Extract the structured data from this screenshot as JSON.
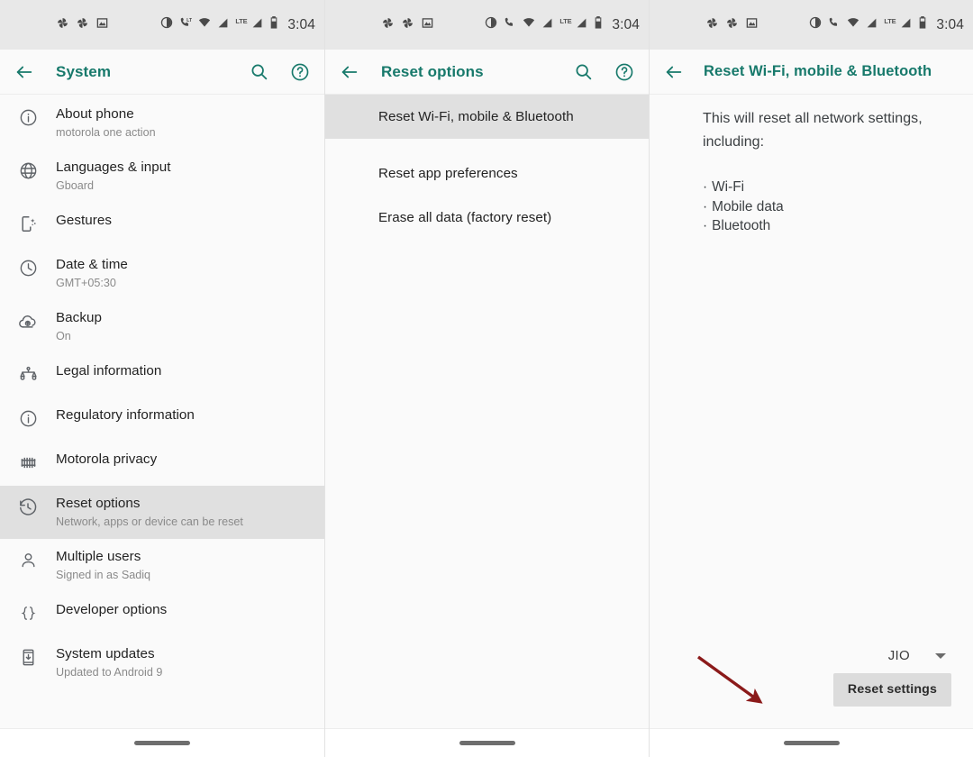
{
  "meta": {
    "accent_color": "#17796b",
    "selected_row_bg": "#e0e0e0",
    "annotation_color": "#8b1a1a",
    "page_bg": "#fafafa"
  },
  "status_bar": {
    "time": "3:04",
    "lte_label": "LTE",
    "left_icons": [
      "sparkle-icon",
      "sparkle-icon",
      "photo-icon"
    ],
    "right_icons": [
      "do-not-disturb-icon",
      "volte-call-icon",
      "wifi-icon",
      "signal-bars-icon",
      "signal-bars-icon",
      "battery-icon"
    ]
  },
  "panels": [
    {
      "id": "system",
      "app_bar": {
        "back": "back-arrow-icon",
        "title": "System",
        "actions": [
          "search-icon",
          "help-icon"
        ]
      },
      "items": [
        {
          "icon": "info-circle-icon",
          "title": "About phone",
          "subtitle": "motorola one action",
          "selected": false
        },
        {
          "icon": "globe-icon",
          "title": "Languages & input",
          "subtitle": "Gboard",
          "selected": false
        },
        {
          "icon": "gestures-phone-icon",
          "title": "Gestures",
          "subtitle": "",
          "selected": false
        },
        {
          "icon": "clock-icon",
          "title": "Date & time",
          "subtitle": "GMT+05:30",
          "selected": false
        },
        {
          "icon": "cloud-upload-icon",
          "title": "Backup",
          "subtitle": "On",
          "selected": false
        },
        {
          "icon": "scales-icon",
          "title": "Legal information",
          "subtitle": "",
          "selected": false
        },
        {
          "icon": "info-circle-icon",
          "title": "Regulatory information",
          "subtitle": "",
          "selected": false
        },
        {
          "icon": "privacy-grid-icon",
          "title": "Motorola privacy",
          "subtitle": "",
          "selected": false
        },
        {
          "icon": "history-reset-icon",
          "title": "Reset options",
          "subtitle": "Network, apps or device can be reset",
          "selected": true
        },
        {
          "icon": "person-icon",
          "title": "Multiple users",
          "subtitle": "Signed in as Sadiq",
          "selected": false
        },
        {
          "icon": "braces-icon",
          "title": "Developer options",
          "subtitle": "",
          "selected": false
        },
        {
          "icon": "phone-download-icon",
          "title": "System updates",
          "subtitle": "Updated to Android 9",
          "selected": false
        }
      ]
    },
    {
      "id": "reset-options",
      "app_bar": {
        "back": "back-arrow-icon",
        "title": "Reset options",
        "actions": [
          "search-icon",
          "help-icon"
        ]
      },
      "items": [
        {
          "title": "Reset Wi-Fi, mobile & Bluetooth",
          "selected": true
        },
        {
          "title": "Reset app preferences",
          "selected": false
        },
        {
          "title": "Erase all data (factory reset)",
          "selected": false
        }
      ]
    },
    {
      "id": "reset-network",
      "app_bar": {
        "back": "back-arrow-icon",
        "title": "Reset Wi-Fi, mobile & Bluetooth",
        "actions": []
      },
      "lead_text": "This will reset all network settings, including:",
      "bullets": [
        "Wi-Fi",
        "Mobile data",
        "Bluetooth"
      ],
      "sim_selector": {
        "value": "JIO",
        "caret": "chevron-down-icon"
      },
      "reset_button": "Reset settings"
    }
  ]
}
